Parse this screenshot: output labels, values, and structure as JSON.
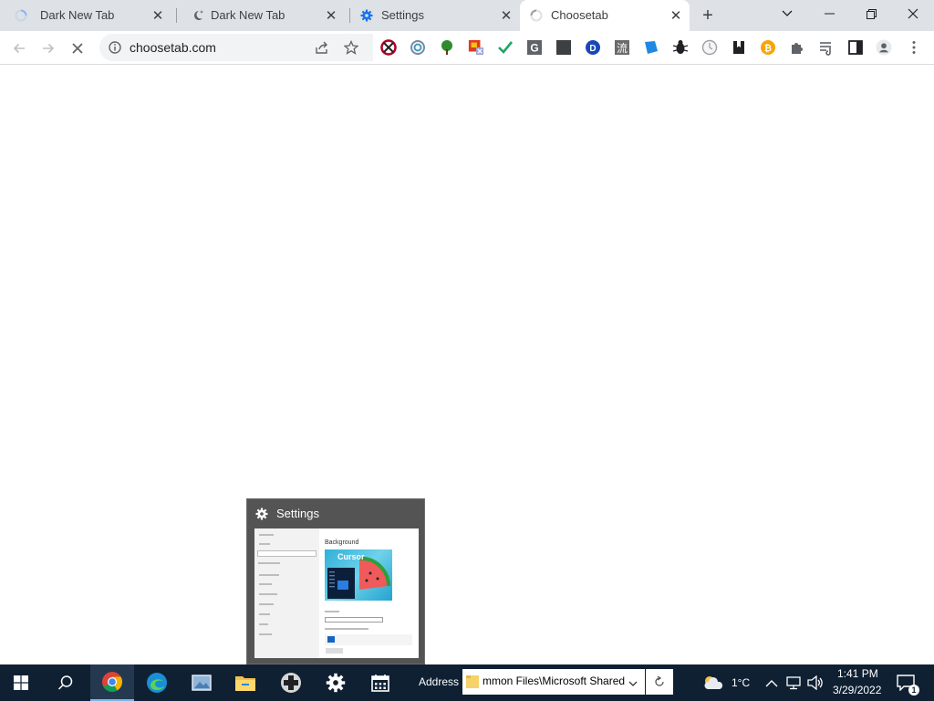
{
  "browser": {
    "tabs": [
      {
        "title": "Dark New Tab",
        "icon": "loading-spinner-icon",
        "active": false
      },
      {
        "title": "Dark New Tab",
        "icon": "moon-star-icon",
        "active": false
      },
      {
        "title": "Settings",
        "icon": "gear-icon",
        "active": false
      },
      {
        "title": "Choosetab",
        "icon": "loading-spinner-icon",
        "active": true
      }
    ],
    "new_tab_label": "+",
    "url": "choosetab.com",
    "extensions": [
      "blocked-sign-extension-icon",
      "ring-extension-icon",
      "tree-extension-icon",
      "flag-extension-icon",
      "checkmark-extension-icon",
      "g-extension-icon",
      "dark-square-extension-icon",
      "d-extension-icon",
      "kanji-extension-icon",
      "blue-tag-extension-icon",
      "bug-extension-icon",
      "clock-extension-icon",
      "bookmark-extension-icon",
      "bitcoin-extension-icon",
      "puzzle-extension-icon"
    ]
  },
  "preview": {
    "title": "Settings",
    "thumb_heading": "Background",
    "thumb_image_text": "Cursor"
  },
  "taskbar": {
    "address_label": "Address",
    "address_value": "mmon Files\\Microsoft Shared",
    "weather_temp": "1°C",
    "time": "1:41 PM",
    "date": "3/29/2022",
    "notification_count": "1"
  },
  "colors": {
    "tab_strip": "#dee1e6",
    "taskbar": "#0f2033",
    "accent_blue": "#1a73e8"
  }
}
